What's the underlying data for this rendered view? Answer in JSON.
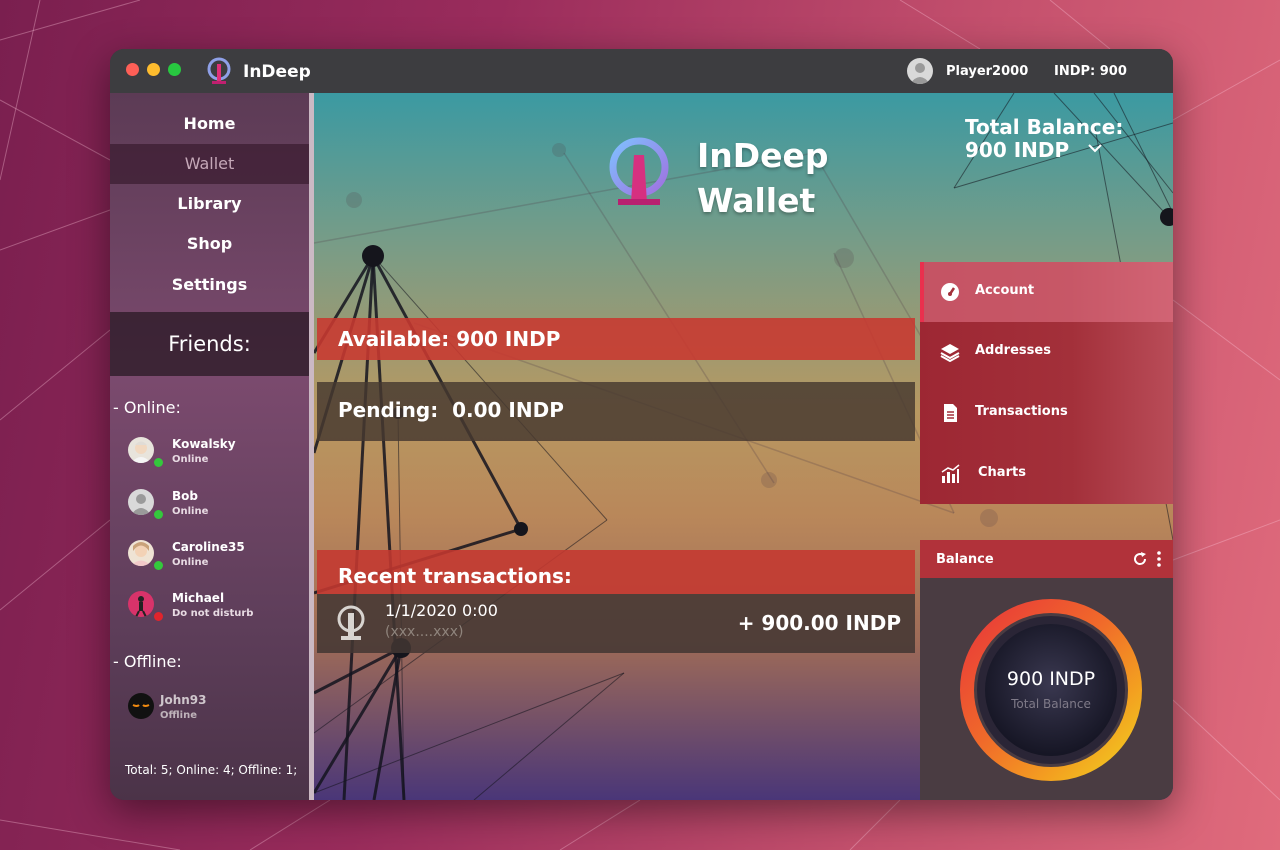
{
  "titlebar": {
    "app_name": "InDeep",
    "user_name": "Player2000",
    "coin_balance": "INDP: 900"
  },
  "sidebar": {
    "nav": [
      {
        "label": "Home",
        "active": false
      },
      {
        "label": "Wallet",
        "active": true
      },
      {
        "label": "Library",
        "active": false
      },
      {
        "label": "Shop",
        "active": false
      },
      {
        "label": "Settings",
        "active": false
      }
    ],
    "friends_heading": "Friends:",
    "online_label": "- Online:",
    "offline_label": "- Offline:",
    "online_friends": [
      {
        "name": "Kowalsky",
        "status": "Online",
        "status_color": "#34c83c"
      },
      {
        "name": "Bob",
        "status": "Online",
        "status_color": "#34c83c"
      },
      {
        "name": "Caroline35",
        "status": "Online",
        "status_color": "#34c83c"
      },
      {
        "name": "Michael",
        "status": "Do not disturb",
        "status_color": "#e0242c"
      }
    ],
    "offline_friends": [
      {
        "name": "John93",
        "status": "Offline"
      }
    ],
    "totals": "Total: 5; Online: 4; Offline: 1;"
  },
  "main": {
    "wallet_title_line1": "InDeep",
    "wallet_title_line2": "Wallet",
    "total_balance_label": "Total Balance:",
    "total_balance_value": "900 INDP",
    "available": "Available: 900 INDP",
    "pending": "Pending:  0.00 INDP",
    "recent_heading": "Recent transactions:",
    "transactions": [
      {
        "date": "1/1/2020 0:00",
        "address": "(xxx....xxx)",
        "amount": "+ 900.00 INDP"
      }
    ]
  },
  "side_menu": [
    {
      "label": "Account",
      "icon": "gauge-icon",
      "active": true
    },
    {
      "label": "Addresses",
      "icon": "layers-icon",
      "active": false
    },
    {
      "label": "Transactions",
      "icon": "document-icon",
      "active": false
    },
    {
      "label": "Charts",
      "icon": "bar-chart-icon",
      "active": false
    }
  ],
  "balance_card": {
    "title": "Balance",
    "value": "900 INDP",
    "label": "Total Balance"
  },
  "colors": {
    "accent_red": "#e9304e",
    "bar_red": "#c83830",
    "online_green": "#34c83c",
    "dnd_red": "#e0242c"
  }
}
